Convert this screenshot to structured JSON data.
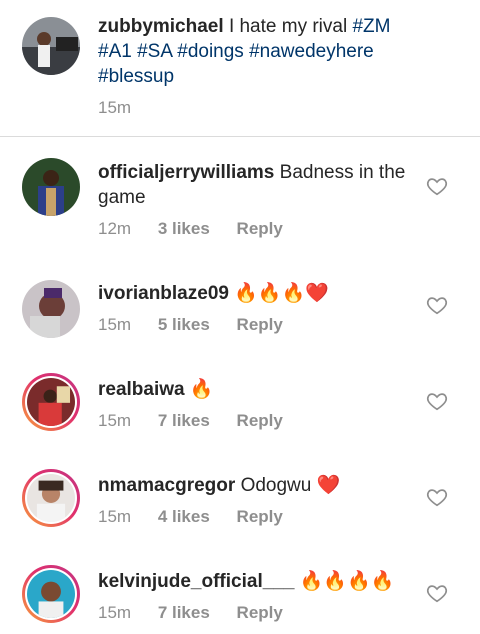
{
  "caption": {
    "username": "zubbymichael",
    "text": "I hate my rival",
    "hashtags": [
      "#ZM",
      "#A1",
      "#SA",
      "#doings",
      "#nawedeyhere",
      "#blessup"
    ],
    "time": "15m"
  },
  "comments": [
    {
      "username": "officialjerrywilliams",
      "text": "Badness in the game",
      "time": "12m",
      "likes": "3 likes",
      "reply": "Reply"
    },
    {
      "username": "ivorianblaze09",
      "text": "🔥🔥🔥❤️",
      "time": "15m",
      "likes": "5 likes",
      "reply": "Reply"
    },
    {
      "username": "realbaiwa",
      "text": "🔥",
      "time": "15m",
      "likes": "7 likes",
      "reply": "Reply"
    },
    {
      "username": "nmamacgregor",
      "text": "Odogwu ❤️",
      "time": "15m",
      "likes": "4 likes",
      "reply": "Reply"
    },
    {
      "username": "kelvinjude_official___",
      "text": "🔥🔥🔥🔥",
      "time": "15m",
      "likes": "7 likes",
      "reply": "Reply"
    }
  ],
  "icons": {
    "like": "heart-outline-icon"
  },
  "colors": {
    "hashtag": "#003569",
    "meta": "#8e8e8e",
    "heart_outline": "#8e8e8e",
    "story_ring_start": "#f9a23b",
    "story_ring_end": "#c13584"
  }
}
